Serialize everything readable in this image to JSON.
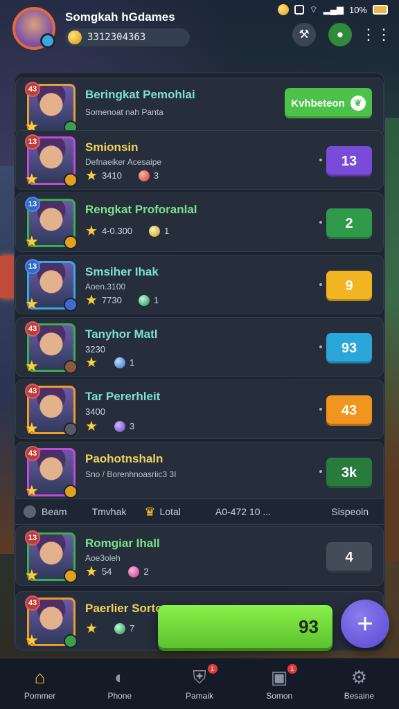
{
  "status_bar": {
    "battery": "10%"
  },
  "header": {
    "title": "Somgkah hGdames",
    "currency": "3312304363"
  },
  "rows": [
    {
      "name": "Beringkat Pemohlai",
      "sub": "Somenoat nah Panta",
      "meta_value": "",
      "gem_count": "",
      "score": "",
      "action_label": "Kvhbeteon",
      "tag": "43",
      "score_color": ""
    },
    {
      "name": "Smionsin",
      "sub": "Defnaeiker Acesaipe",
      "meta_value": "3410",
      "gem_count": "3",
      "score": "13",
      "tag": "13",
      "score_color": "#7a4ad8"
    },
    {
      "name": "Rengkat Proforanlal",
      "sub": "",
      "meta_value": "4-0.300",
      "gem_count": "1",
      "score": "2",
      "tag": "13",
      "score_color": "#2f9a4a"
    },
    {
      "name": "Smsiher Ihak",
      "sub": "Aoen.3100",
      "meta_value": "7730",
      "gem_count": "1",
      "score": "9",
      "tag": "13",
      "score_color": "#f0b520"
    },
    {
      "name": "Tanyhor Matl",
      "sub": "",
      "meta_value": "3230",
      "gem_count": "1",
      "score": "93",
      "tag": "43",
      "score_color": "#2aa7d8"
    },
    {
      "name": "Tar Pererhleit",
      "sub": "",
      "meta_value": "3400",
      "gem_count": "3",
      "score": "43",
      "tag": "43",
      "score_color": "#f0951e"
    },
    {
      "name": "Paohotnshaln",
      "sub": "Sno / Borenhnoasriic3 3I",
      "meta_value": "",
      "gem_count": "",
      "score": "3k",
      "tag": "43",
      "score_color": "#2a7a3e"
    }
  ],
  "column_strip": {
    "col1": "Beam",
    "col2": "Tmvhak",
    "col3": "Lotal",
    "col4": "A0-472 10 ...",
    "col5": "Sispeoln"
  },
  "rows_lower": [
    {
      "name": "Romgiar Ihall",
      "sub": "Aoe3oleh",
      "meta_value": "54",
      "gem_count": "2",
      "score": "4",
      "tag": "13",
      "score_color": "#444c58"
    },
    {
      "name": "Paerlier Sortone",
      "sub": "",
      "meta_value": "",
      "gem_count": "7",
      "score": "",
      "tag": "43",
      "score_color": "#2a8a5a"
    }
  ],
  "big_button_value": "93",
  "bottom_nav": [
    {
      "label": "Pommer",
      "icon": "home-icon"
    },
    {
      "label": "Phone",
      "icon": "profile-icon"
    },
    {
      "label": "Pamaik",
      "icon": "shield-icon",
      "badge": "1"
    },
    {
      "label": "Somon",
      "icon": "shop-icon",
      "badge": "1"
    },
    {
      "label": "Besaine",
      "icon": "gear-icon"
    }
  ]
}
